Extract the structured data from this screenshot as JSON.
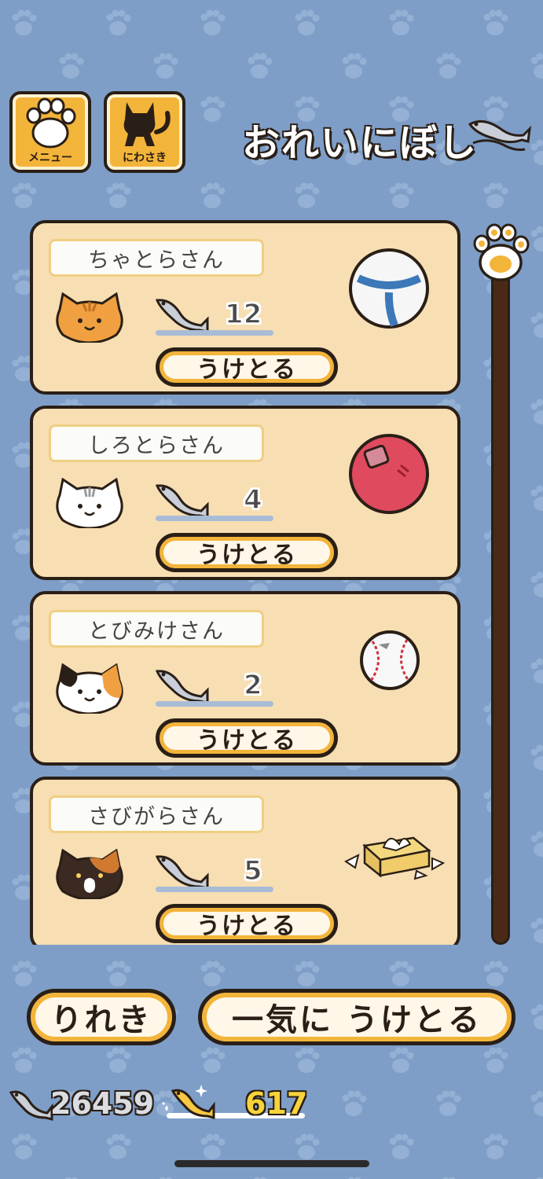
{
  "header": {
    "menu_label": "メニュー",
    "yard_label": "にわさき",
    "title": "おれいにぼし"
  },
  "cards": [
    {
      "name": "ちゃとらさん",
      "count": "12",
      "button": "うけとる",
      "cat_color": "#f0a040",
      "toy": "blue-ball"
    },
    {
      "name": "しろとらさん",
      "count": "4",
      "button": "うけとる",
      "cat_color": "#ffffff",
      "toy": "red-ball"
    },
    {
      "name": "とびみけさん",
      "count": "2",
      "button": "うけとる",
      "cat_color": "#ffffff",
      "toy": "baseball"
    },
    {
      "name": "さびがらさん",
      "count": "5",
      "button": "うけとる",
      "cat_color": "#3a2a22",
      "toy": "tissue-box"
    }
  ],
  "footer": {
    "history_label": "りれき",
    "receive_all_label": "一気に うけとる",
    "silver_fish": "26459",
    "gold_fish": "617"
  },
  "colors": {
    "background": "#7e9ec8",
    "card": "#f7deb3",
    "accent": "#f3b43a",
    "gold": "#f7d33a"
  }
}
